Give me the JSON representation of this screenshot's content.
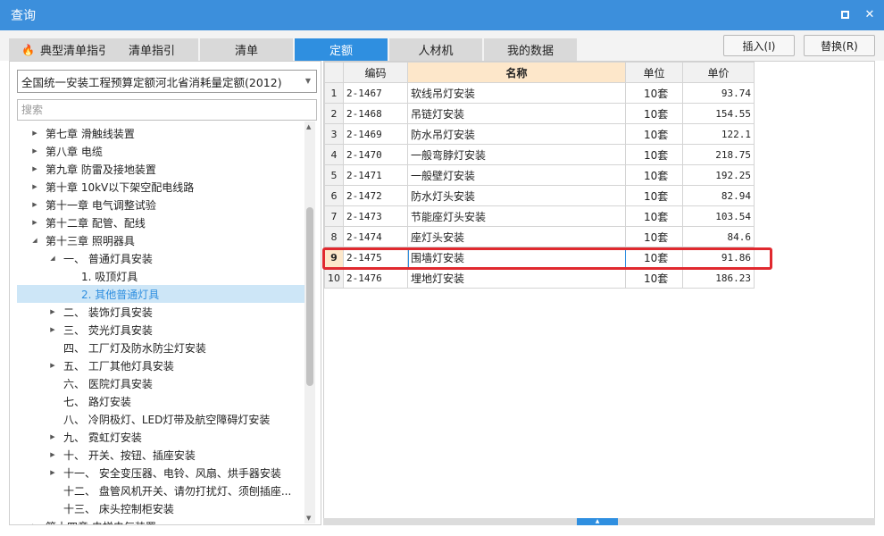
{
  "window": {
    "title": "查询",
    "maximize_label": "□",
    "close_label": "✕"
  },
  "tabs": [
    {
      "label": "典型清单指引",
      "active": false
    },
    {
      "label": "清单指引",
      "active": false
    },
    {
      "label": "清单",
      "active": false
    },
    {
      "label": "定额",
      "active": true
    },
    {
      "label": "人材机",
      "active": false
    },
    {
      "label": "我的数据",
      "active": false
    }
  ],
  "actions": {
    "insert_label": "插入(I)",
    "replace_label": "替换(R)"
  },
  "left": {
    "dropdown_value": "全国统一安装工程预算定额河北省消耗量定额(2012)",
    "search_placeholder": "搜索",
    "tree": [
      {
        "label": "第七章 滑触线装置",
        "indent": 0,
        "arrow": "▶"
      },
      {
        "label": "第八章 电缆",
        "indent": 0,
        "arrow": "▶"
      },
      {
        "label": "第九章 防雷及接地装置",
        "indent": 0,
        "arrow": "▶"
      },
      {
        "label": "第十章 10kV以下架空配电线路",
        "indent": 0,
        "arrow": "▶"
      },
      {
        "label": "第十一章 电气调整试验",
        "indent": 0,
        "arrow": "▶"
      },
      {
        "label": "第十二章 配管、配线",
        "indent": 0,
        "arrow": "▶"
      },
      {
        "label": "第十三章 照明器具",
        "indent": 0,
        "arrow": "◢"
      },
      {
        "label": "一、 普通灯具安装",
        "indent": 1,
        "arrow": "◢"
      },
      {
        "label": "1. 吸顶灯具",
        "indent": 2,
        "arrow": ""
      },
      {
        "label": "2. 其他普通灯具",
        "indent": 2,
        "arrow": "",
        "selected": true
      },
      {
        "label": "二、 装饰灯具安装",
        "indent": 1,
        "arrow": "▶"
      },
      {
        "label": "三、 荧光灯具安装",
        "indent": 1,
        "arrow": "▶"
      },
      {
        "label": "四、 工厂灯及防水防尘灯安装",
        "indent": 1,
        "arrow": ""
      },
      {
        "label": "五、 工厂其他灯具安装",
        "indent": 1,
        "arrow": "▶"
      },
      {
        "label": "六、 医院灯具安装",
        "indent": 1,
        "arrow": ""
      },
      {
        "label": "七、 路灯安装",
        "indent": 1,
        "arrow": ""
      },
      {
        "label": "八、 冷阴极灯、LED灯带及航空障碍灯安装",
        "indent": 1,
        "arrow": ""
      },
      {
        "label": "九、 霓虹灯安装",
        "indent": 1,
        "arrow": "▶"
      },
      {
        "label": "十、 开关、按钮、插座安装",
        "indent": 1,
        "arrow": "▶"
      },
      {
        "label": "十一、 安全变压器、电铃、风扇、烘手器安装",
        "indent": 1,
        "arrow": "▶"
      },
      {
        "label": "十二、 盘管风机开关、请勿打扰灯、须刨插座...",
        "indent": 1,
        "arrow": ""
      },
      {
        "label": "十三、 床头控制柜安装",
        "indent": 1,
        "arrow": ""
      },
      {
        "label": "第十四章 电梯电气装置",
        "indent": 0,
        "arrow": "▶"
      }
    ]
  },
  "table": {
    "headers": [
      "编码",
      "名称",
      "单位",
      "单价"
    ],
    "rows": [
      {
        "idx": "1",
        "code": "2-1467",
        "name": "软线吊灯安装",
        "unit": "10套",
        "price": "93.74"
      },
      {
        "idx": "2",
        "code": "2-1468",
        "name": "吊链灯安装",
        "unit": "10套",
        "price": "154.55"
      },
      {
        "idx": "3",
        "code": "2-1469",
        "name": "防水吊灯安装",
        "unit": "10套",
        "price": "122.1"
      },
      {
        "idx": "4",
        "code": "2-1470",
        "name": "一般弯脖灯安装",
        "unit": "10套",
        "price": "218.75"
      },
      {
        "idx": "5",
        "code": "2-1471",
        "name": "一般壁灯安装",
        "unit": "10套",
        "price": "192.25"
      },
      {
        "idx": "6",
        "code": "2-1472",
        "name": "防水灯头安装",
        "unit": "10套",
        "price": "82.94"
      },
      {
        "idx": "7",
        "code": "2-1473",
        "name": "节能座灯头安装",
        "unit": "10套",
        "price": "103.54"
      },
      {
        "idx": "8",
        "code": "2-1474",
        "name": "座灯头安装",
        "unit": "10套",
        "price": "84.6"
      },
      {
        "idx": "9",
        "code": "2-1475",
        "name": "围墙灯安装",
        "unit": "10套",
        "price": "91.86",
        "selected": true
      },
      {
        "idx": "10",
        "code": "2-1476",
        "name": "埋地灯安装",
        "unit": "10套",
        "price": "186.23"
      }
    ]
  },
  "colors": {
    "accent": "#2f8fe0",
    "titlebar": "#3c8fdc",
    "highlight": "#e0292f",
    "header_selected": "#fde7ca"
  }
}
